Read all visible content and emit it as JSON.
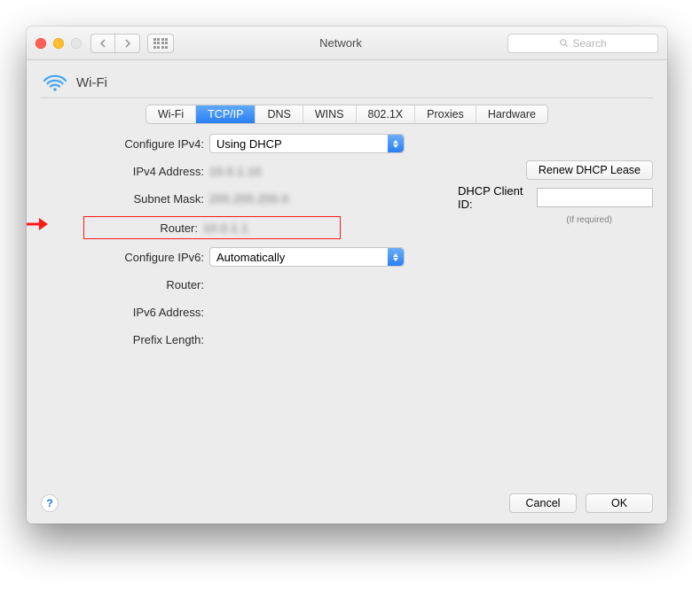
{
  "window": {
    "title": "Network",
    "search_placeholder": "Search"
  },
  "header": {
    "interface": "Wi-Fi"
  },
  "tabs": {
    "items": [
      "Wi-Fi",
      "TCP/IP",
      "DNS",
      "WINS",
      "802.1X",
      "Proxies",
      "Hardware"
    ],
    "active_index": 1
  },
  "ipv4": {
    "configure_label": "Configure IPv4:",
    "configure_value": "Using DHCP",
    "address_label": "IPv4 Address:",
    "address_value": "10.0.1.10",
    "subnet_label": "Subnet Mask:",
    "subnet_value": "255.255.255.0",
    "router_label": "Router:",
    "router_value": "10.0.1.1",
    "renew_button": "Renew DHCP Lease",
    "client_id_label": "DHCP Client ID:",
    "client_id_hint": "(If required)"
  },
  "ipv6": {
    "configure_label": "Configure IPv6:",
    "configure_value": "Automatically",
    "router_label": "Router:",
    "address_label": "IPv6 Address:",
    "prefix_label": "Prefix Length:"
  },
  "footer": {
    "cancel": "Cancel",
    "ok": "OK"
  },
  "annotation": {
    "arrow_color": "#ff1a1a"
  }
}
